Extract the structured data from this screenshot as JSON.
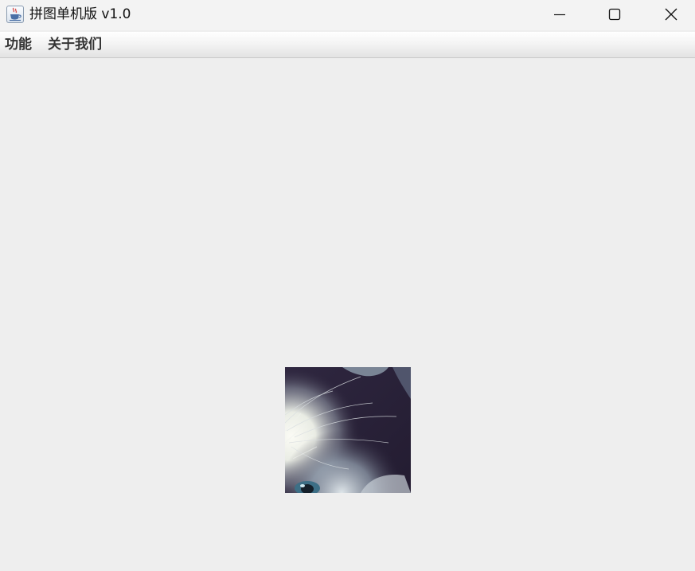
{
  "window": {
    "title": "拼图单机版 v1.0",
    "icon": "java-coffee-icon",
    "controls": [
      "minimize-icon",
      "maximize-icon",
      "close-icon"
    ]
  },
  "menubar": {
    "items": [
      {
        "label": "功能"
      },
      {
        "label": "关于我们"
      }
    ]
  },
  "content": {
    "tile": {
      "description_icon": "puzzle-tile-image"
    }
  },
  "colors": {
    "background": "#eeeeee",
    "titlebar": "#f3f3f3",
    "menu_text": "#333333",
    "tile_dark": "#2a2238"
  }
}
